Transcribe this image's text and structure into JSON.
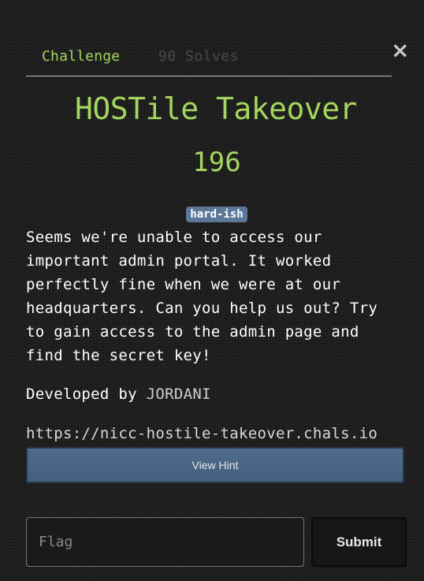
{
  "tabs": {
    "challenge": "Challenge",
    "solves": "90 Solves"
  },
  "close_icon": "×",
  "challenge": {
    "title": "HOSTile Takeover",
    "points": "196",
    "tag": "hard-ish",
    "description": "Seems we're unable to access our important admin portal. It worked perfectly fine when we were at our headquarters. Can you help us out? Try to gain access to the admin page and find the secret key!",
    "developed_by_label": "Developed by",
    "author": "JORDANI",
    "url": "https://nicc-hostile-takeover.chals.io"
  },
  "hint_button": "View Hint",
  "flag": {
    "placeholder": "Flag",
    "value": ""
  },
  "submit_button": "Submit",
  "colors": {
    "accent_green": "#a4d65e",
    "badge_blue": "#5c7899",
    "hint_button": "#4f6a8b",
    "background": "#1e1e1e"
  }
}
